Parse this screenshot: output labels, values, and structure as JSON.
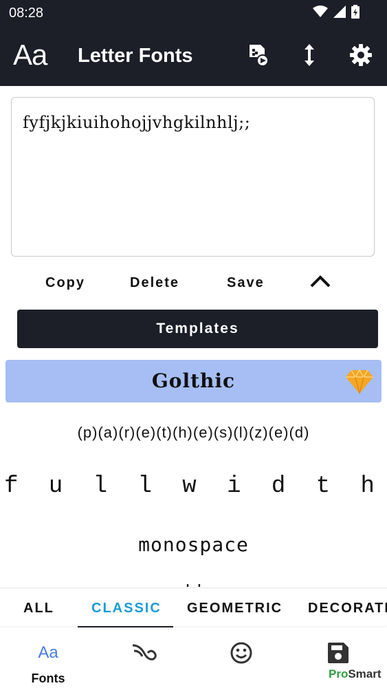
{
  "status": {
    "time": "08:28"
  },
  "appbar": {
    "logo": "Aa",
    "title": "Letter Fonts"
  },
  "editor": {
    "text": "fyfjkjkiuihohojjvhgkilnhlj;;"
  },
  "actions": {
    "copy": "Copy",
    "delete": "Delete",
    "save": "Save"
  },
  "templates_label": "Templates",
  "font_list": {
    "selected": "Golthic",
    "items": [
      "(p)(a)(r)(e)(t)(h)(e)(s)(l)(z)(e)(d)",
      "f u l l w i d t h",
      "monospace",
      "''"
    ]
  },
  "tabs": [
    "ALL",
    "CLASSIC",
    "GEOMETRIC",
    "DECORATI"
  ],
  "active_tab": "CLASSIC",
  "bottom_nav": {
    "fonts_label": "Fonts",
    "fonts_icon_text": "Aa"
  },
  "watermark": {
    "pro": "Pro",
    "smart": "Smart"
  },
  "colors": {
    "appbar": "#1c1e28",
    "selected_row": "#a6bef3",
    "active_tab": "#1a9bd7",
    "watermark_green": "#2e9d3c",
    "gem": "#f5a623"
  }
}
